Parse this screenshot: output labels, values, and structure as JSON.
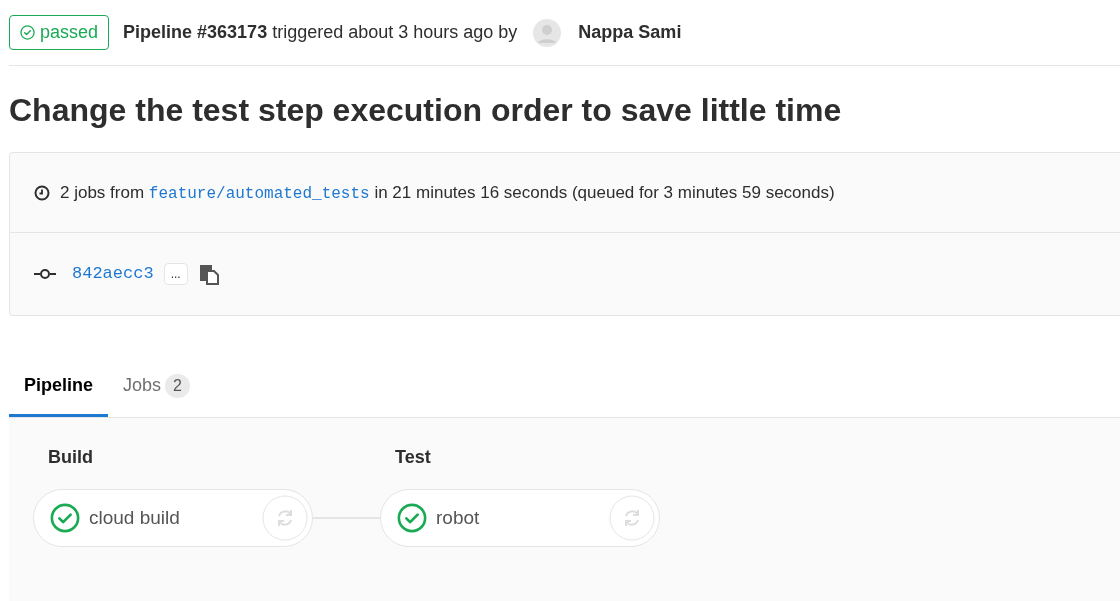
{
  "header": {
    "status": {
      "label": "passed",
      "kind": "success"
    },
    "pipeline": "Pipeline #363173",
    "text": "triggered about 3 hours ago by",
    "user": "Nappa Sami"
  },
  "title": "Change the test step execution order to save little time",
  "info": {
    "jobs": "2 jobs from",
    "branch": "feature/automated_tests",
    "duration": "in 21 minutes 16 seconds (queued for 3 minutes 59 seconds)",
    "commit": "842aecc3",
    "expand": "..."
  },
  "tabs": [
    {
      "label": "Pipeline",
      "selected": true
    },
    {
      "label": "Jobs",
      "count": "2",
      "selected": false
    }
  ],
  "stages": [
    {
      "name": "Build",
      "jobs": [
        {
          "name": "cloud build",
          "passed": true
        }
      ]
    },
    {
      "name": "Test",
      "jobs": [
        {
          "name": "robot",
          "passed": true
        }
      ]
    }
  ]
}
